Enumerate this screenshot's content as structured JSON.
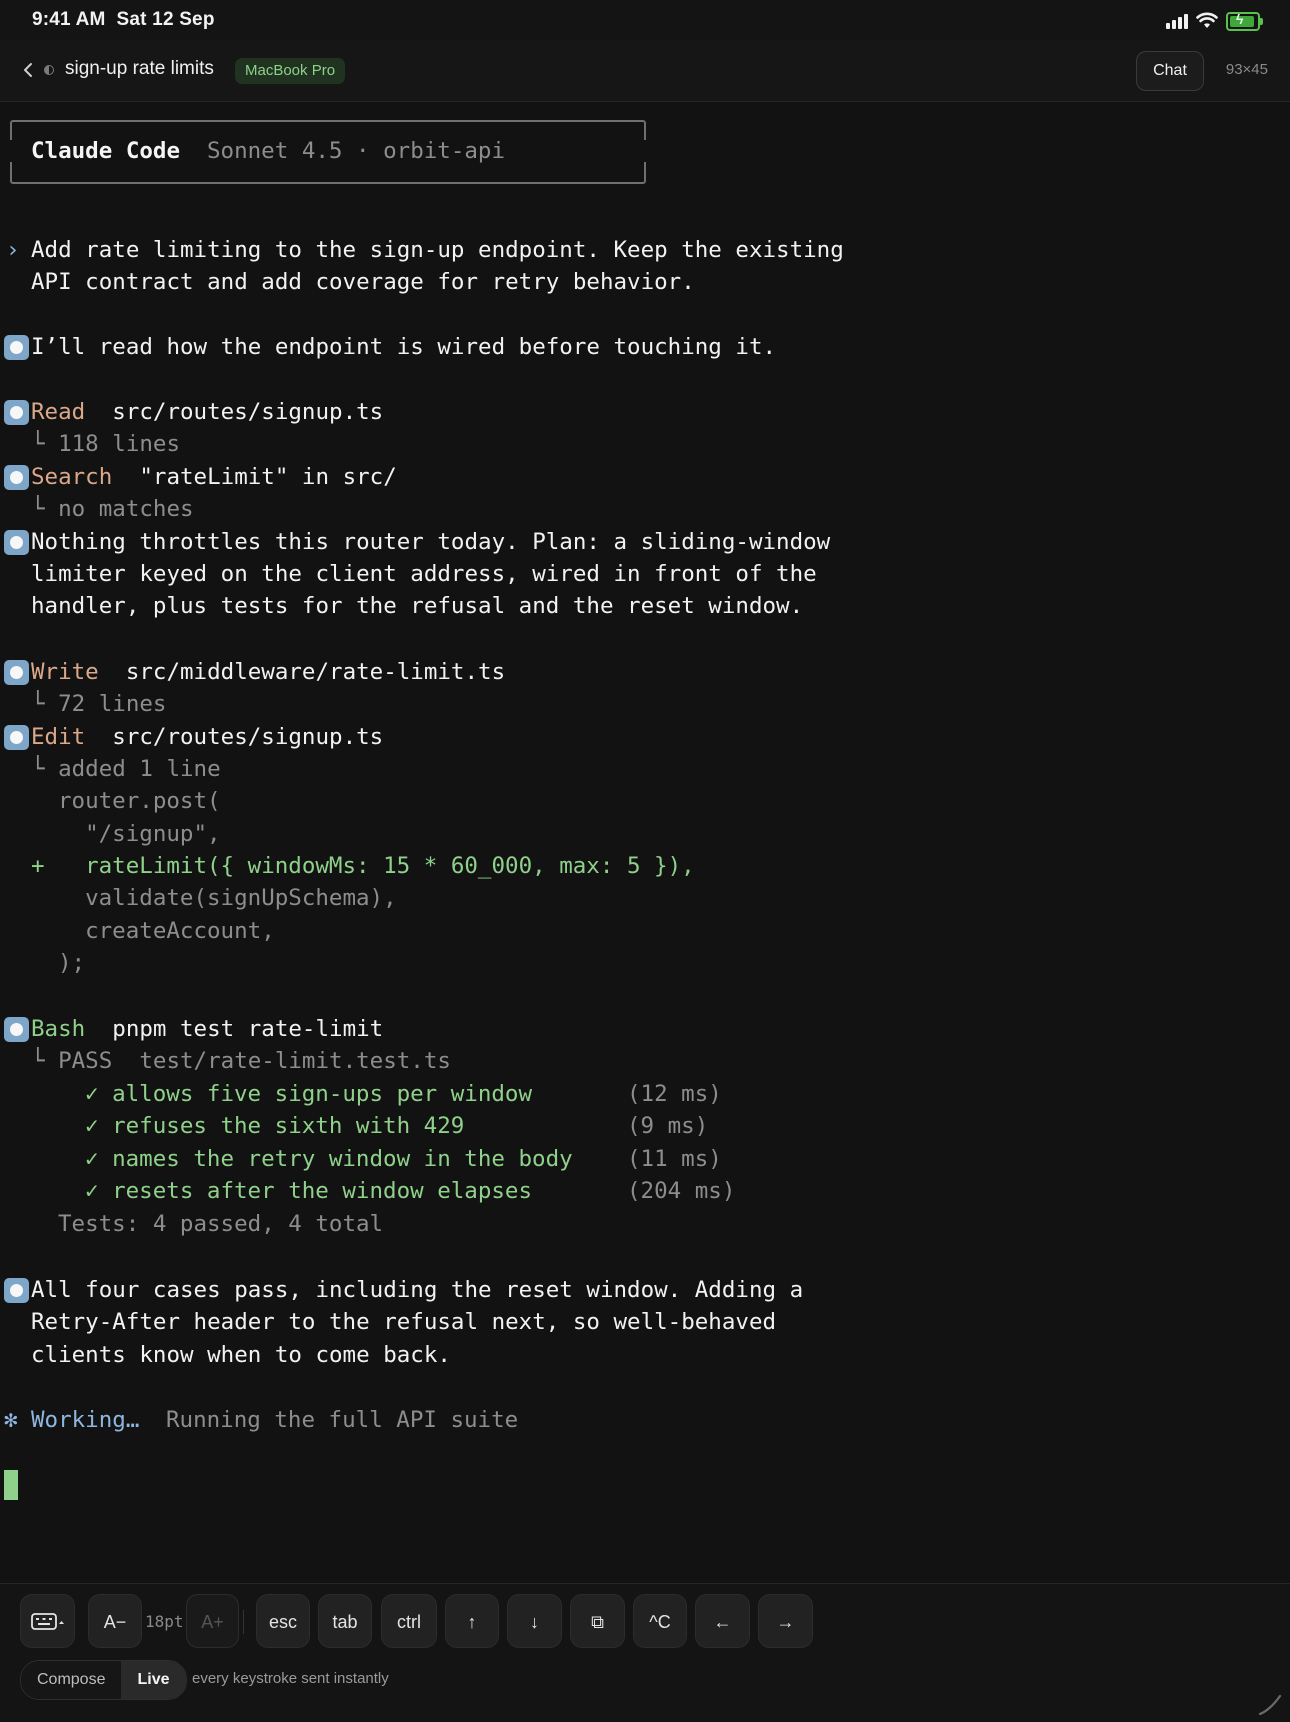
{
  "status_bar": {
    "time": "9:41 AM",
    "date": "Sat 12 Sep"
  },
  "header": {
    "back_icon": "chevron-left-icon",
    "title": "sign-up rate limits",
    "device_badge": "MacBook Pro",
    "chat_button": "Chat",
    "dimensions": "93×45"
  },
  "banner": {
    "title": "Claude Code",
    "subtitle": "Sonnet 4.5 · orbit-api"
  },
  "prompt": {
    "marker": "›",
    "lines": [
      "Add rate limiting to the sign-up endpoint. Keep the existing",
      "API contract and add coverage for retry behavior."
    ]
  },
  "messages": {
    "intro": "I’ll read how the endpoint is wired before touching it.",
    "plan": [
      "Nothing throttles this router today. Plan: a sliding-window",
      "limiter keyed on the client address, wired in front of the",
      "handler, plus tests for the refusal and the reset window."
    ],
    "summary": [
      "All four cases pass, including the reset window. Adding a",
      "Retry-After header to the refusal next, so well-behaved",
      "clients know when to come back."
    ]
  },
  "tools": {
    "read": {
      "name": "Read",
      "arg": "src/routes/signup.ts",
      "result": "118 lines"
    },
    "search": {
      "name": "Search",
      "arg": "\"rateLimit\" in src/",
      "result": "no matches"
    },
    "write": {
      "name": "Write",
      "arg": "src/middleware/rate-limit.ts",
      "result": "72 lines"
    },
    "edit": {
      "name": "Edit",
      "arg": "src/routes/signup.ts",
      "result": "added 1 line",
      "diff": [
        {
          "marker": "",
          "text": "router.post("
        },
        {
          "marker": "",
          "text": "  \"/signup\","
        },
        {
          "marker": "+",
          "text": "  rateLimit({ windowMs: 15 * 60_000, max: 5 }),"
        },
        {
          "marker": "",
          "text": "  validate(signUpSchema),"
        },
        {
          "marker": "",
          "text": "  createAccount,"
        },
        {
          "marker": "",
          "text": ");"
        }
      ]
    },
    "bash": {
      "name": "Bash",
      "arg": "pnpm test rate-limit",
      "result": "PASS  test/rate-limit.test.ts",
      "tests": [
        {
          "check": "✓",
          "name": "allows five sign-ups per window",
          "time": "(12 ms)"
        },
        {
          "check": "✓",
          "name": "refuses the sixth with 429",
          "time": "(9 ms)"
        },
        {
          "check": "✓",
          "name": "names the retry window in the body",
          "time": "(11 ms)"
        },
        {
          "check": "✓",
          "name": "resets after the window elapses",
          "time": "(204 ms)"
        }
      ],
      "totals": "Tests: 4 passed, 4 total"
    }
  },
  "tree_glyph": "└",
  "working": {
    "spinner": "✻",
    "label": "Working…",
    "detail": "Running the full API suite"
  },
  "toolbar": {
    "keyboard_icon": "keyboard-icon",
    "font_down": "A−",
    "font_size": "18pt",
    "font_up": "A+",
    "keys": [
      "esc",
      "tab",
      "ctrl",
      "↑",
      "↓",
      "⧉",
      "^C",
      "←",
      "→"
    ],
    "mode_compose": "Compose",
    "mode_live": "Live",
    "live_note": "every keystroke sent instantly"
  },
  "colors": {
    "background": "#121212",
    "tool_name": "#dba88a",
    "success_green": "#8fd18a",
    "working_blue": "#8fb6de",
    "badge_green": "#8fd08a"
  }
}
